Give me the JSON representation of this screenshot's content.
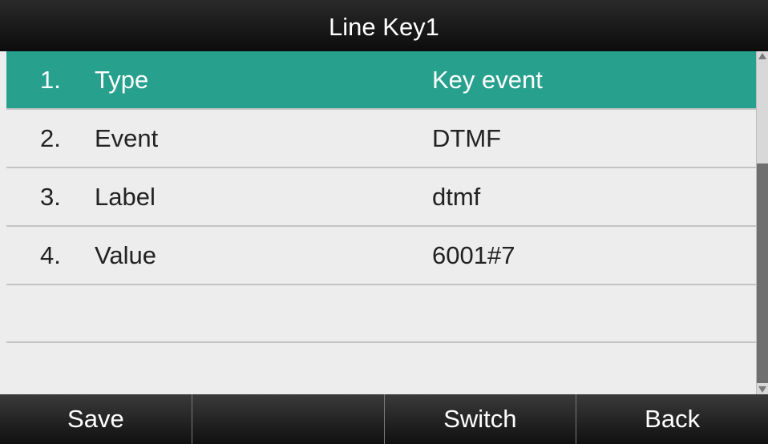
{
  "title": "Line Key1",
  "rows": [
    {
      "num": "1.",
      "name": "Type",
      "value": "Key event",
      "selected": true
    },
    {
      "num": "2.",
      "name": "Event",
      "value": "DTMF",
      "selected": false
    },
    {
      "num": "3.",
      "name": "Label",
      "value": "dtmf",
      "selected": false
    },
    {
      "num": "4.",
      "name": "Value",
      "value": "6001#7",
      "selected": false
    }
  ],
  "softkeys": {
    "key1": "Save",
    "key2": "",
    "key3": "Switch",
    "key4": "Back"
  },
  "colors": {
    "selected_row": "#27a08e",
    "list_background": "#ededed",
    "bar_background": "#111111"
  },
  "icons": {
    "scroll_up": "scroll-up-arrow-icon",
    "scroll_down": "scroll-down-arrow-icon"
  }
}
